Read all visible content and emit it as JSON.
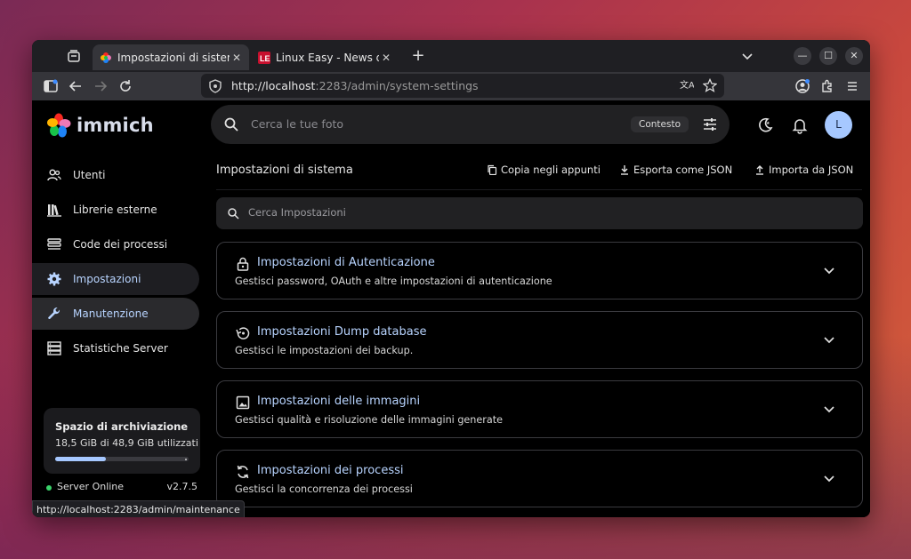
{
  "browser": {
    "tabs": [
      {
        "title": "Impostazioni di sistema - I",
        "active": true
      },
      {
        "title": "Linux Easy - News da Mon",
        "active": false
      }
    ],
    "url_scheme_host": "http://localhost",
    "url_rest": ":2283/admin/system-settings",
    "status_link": "http://localhost:2283/admin/maintenance"
  },
  "app": {
    "name": "immich",
    "search_placeholder": "Cerca le tue foto",
    "context_label": "Contesto",
    "avatar_initial": "L"
  },
  "sidebar": {
    "items": [
      {
        "label": "Utenti",
        "icon": "users-icon",
        "state": "normal"
      },
      {
        "label": "Librerie esterne",
        "icon": "library-icon",
        "state": "normal"
      },
      {
        "label": "Code dei processi",
        "icon": "job-queue-icon",
        "state": "normal"
      },
      {
        "label": "Impostazioni",
        "icon": "gear-icon",
        "state": "active"
      },
      {
        "label": "Manutenzione",
        "icon": "wrench-icon",
        "state": "hover"
      },
      {
        "label": "Statistiche Server",
        "icon": "server-icon",
        "state": "normal"
      }
    ],
    "storage": {
      "title": "Spazio di archiviazione",
      "used_text": "18,5 GiB di 48,9 GiB utilizzati",
      "used_fraction": 0.378
    },
    "server_status": "Server Online",
    "server_version": "v2.7.5"
  },
  "main": {
    "title": "Impostazioni di sistema",
    "actions": {
      "copy": "Copia negli appunti",
      "export": "Esporta come JSON",
      "import": "Importa da JSON"
    },
    "search_placeholder": "Cerca Impostazioni",
    "sections": [
      {
        "title": "Impostazioni di Autenticazione",
        "desc": "Gestisci password, OAuth e altre impostazioni di autenticazione",
        "icon": "lock-icon"
      },
      {
        "title": "Impostazioni Dump database",
        "desc": "Gestisci le impostazioni dei backup.",
        "icon": "backup-restore-icon"
      },
      {
        "title": "Impostazioni delle immagini",
        "desc": "Gestisci qualità e risoluzione delle immagini generate",
        "icon": "image-icon"
      },
      {
        "title": "Impostazioni dei processi",
        "desc": "Gestisci la concorrenza dei processi",
        "icon": "sync-icon"
      }
    ]
  },
  "colors": {
    "accent": "#b8d4ff",
    "online": "#3ad36a"
  }
}
